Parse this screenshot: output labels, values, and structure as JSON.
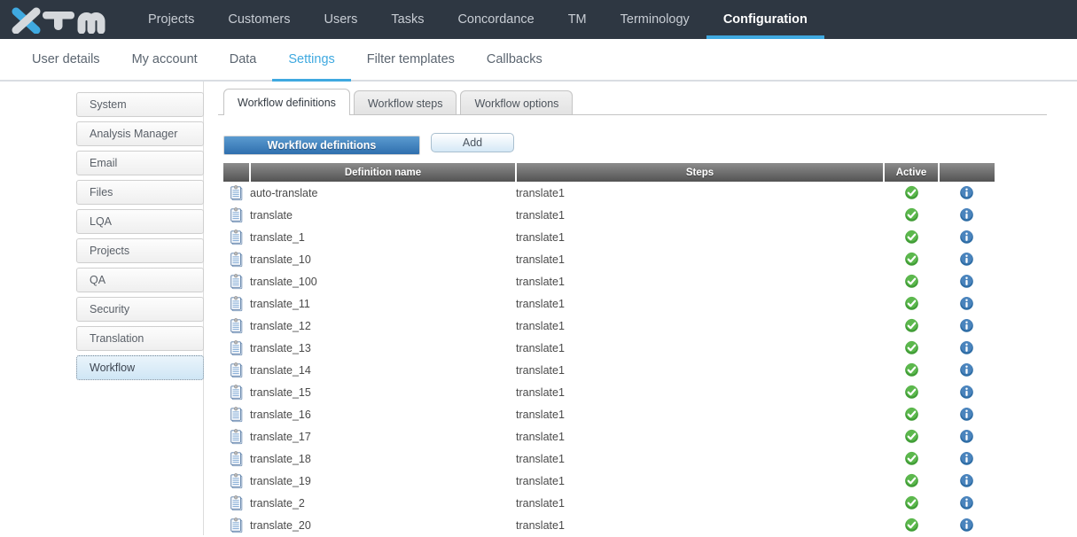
{
  "brand": {
    "logo_text": "XTM",
    "accent_blue": "#3fa9e0",
    "nav_bg": "#2e3742"
  },
  "topnav": {
    "items": [
      {
        "label": "Projects",
        "active": false
      },
      {
        "label": "Customers",
        "active": false
      },
      {
        "label": "Users",
        "active": false
      },
      {
        "label": "Tasks",
        "active": false
      },
      {
        "label": "Concordance",
        "active": false
      },
      {
        "label": "TM",
        "active": false
      },
      {
        "label": "Terminology",
        "active": false
      },
      {
        "label": "Configuration",
        "active": true
      }
    ]
  },
  "subnav": {
    "items": [
      {
        "label": "User details",
        "active": false
      },
      {
        "label": "My account",
        "active": false
      },
      {
        "label": "Data",
        "active": false
      },
      {
        "label": "Settings",
        "active": true
      },
      {
        "label": "Filter templates",
        "active": false
      },
      {
        "label": "Callbacks",
        "active": false
      }
    ]
  },
  "sidebar": {
    "items": [
      {
        "label": "System",
        "selected": false
      },
      {
        "label": "Analysis Manager",
        "selected": false
      },
      {
        "label": "Email",
        "selected": false
      },
      {
        "label": "Files",
        "selected": false
      },
      {
        "label": "LQA",
        "selected": false
      },
      {
        "label": "Projects",
        "selected": false
      },
      {
        "label": "QA",
        "selected": false
      },
      {
        "label": "Security",
        "selected": false
      },
      {
        "label": "Translation",
        "selected": false
      },
      {
        "label": "Workflow",
        "selected": true
      }
    ]
  },
  "content": {
    "tabs": [
      {
        "label": "Workflow definitions",
        "active": true
      },
      {
        "label": "Workflow steps",
        "active": false
      },
      {
        "label": "Workflow options",
        "active": false
      }
    ],
    "panel_title": "Workflow definitions",
    "add_button": "Add",
    "table": {
      "headers": [
        "",
        "Definition name",
        "Steps",
        "Active",
        ""
      ],
      "rows": [
        {
          "name": "auto-translate",
          "steps": "translate1",
          "active": true
        },
        {
          "name": "translate",
          "steps": "translate1",
          "active": true
        },
        {
          "name": "translate_1",
          "steps": "translate1",
          "active": true
        },
        {
          "name": "translate_10",
          "steps": "translate1",
          "active": true
        },
        {
          "name": "translate_100",
          "steps": "translate1",
          "active": true
        },
        {
          "name": "translate_11",
          "steps": "translate1",
          "active": true
        },
        {
          "name": "translate_12",
          "steps": "translate1",
          "active": true
        },
        {
          "name": "translate_13",
          "steps": "translate1",
          "active": true
        },
        {
          "name": "translate_14",
          "steps": "translate1",
          "active": true
        },
        {
          "name": "translate_15",
          "steps": "translate1",
          "active": true
        },
        {
          "name": "translate_16",
          "steps": "translate1",
          "active": true
        },
        {
          "name": "translate_17",
          "steps": "translate1",
          "active": true
        },
        {
          "name": "translate_18",
          "steps": "translate1",
          "active": true
        },
        {
          "name": "translate_19",
          "steps": "translate1",
          "active": true
        },
        {
          "name": "translate_2",
          "steps": "translate1",
          "active": true
        },
        {
          "name": "translate_20",
          "steps": "translate1",
          "active": true
        }
      ]
    },
    "icons": {
      "row": "document-icon",
      "active": "check-circle-icon",
      "info": "info-circle-icon"
    }
  }
}
